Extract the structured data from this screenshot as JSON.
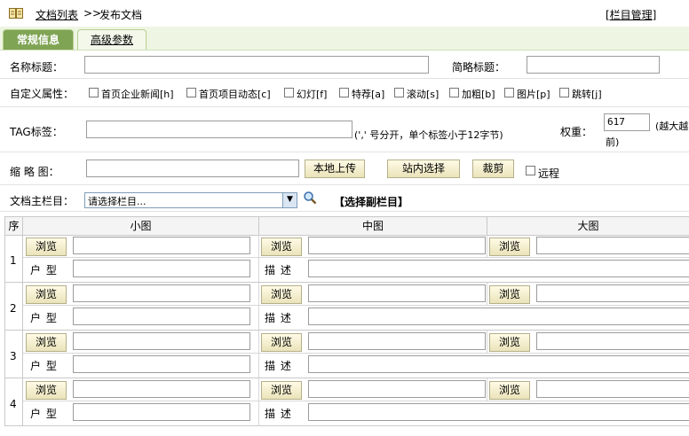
{
  "breadcrumb": {
    "list_link": "文档列表",
    "separator": ">>",
    "current": "发布文档",
    "manage_link": "[栏目管理]"
  },
  "tabs": [
    {
      "label": "常规信息",
      "active": true
    },
    {
      "label": "高级参数",
      "active": false
    }
  ],
  "form": {
    "title_label": "名称标题：",
    "short_title_label": "简略标题：",
    "attr_label": "自定义属性：",
    "attrs": [
      "首页企业新闻[h]",
      "首页项目动态[c]",
      "幻灯[f]",
      "特荐[a]",
      "滚动[s]",
      "加粗[b]",
      "图片[p]",
      "跳转[j]"
    ],
    "tag_label": "TAG标签：",
    "tag_hint": "(',' 号分开，单个标签小于12字节)",
    "weight_label": "权重：",
    "weight_value": "617",
    "weight_hint_a": "(越大越",
    "weight_hint_b": "前)",
    "thumb_label": "缩 略 图：",
    "upload_btn": "本地上传",
    "site_select_btn": "站内选择",
    "crop_btn": "裁剪",
    "remote_label": "远程",
    "category_label": "文档主栏目：",
    "category_select": "请选择栏目...",
    "sub_category_link": "【选择副栏目】"
  },
  "grid": {
    "headers": [
      "序",
      "小图",
      "中图",
      "大图"
    ],
    "browse_label": "浏览",
    "type_label": "户 型",
    "desc_label": "描 述",
    "rows": [
      "1",
      "2",
      "3",
      "4"
    ]
  },
  "colors": {
    "tab_active": "#7fa454",
    "tab_bg": "#eef5e2",
    "button_bg": "#eae3b9"
  }
}
